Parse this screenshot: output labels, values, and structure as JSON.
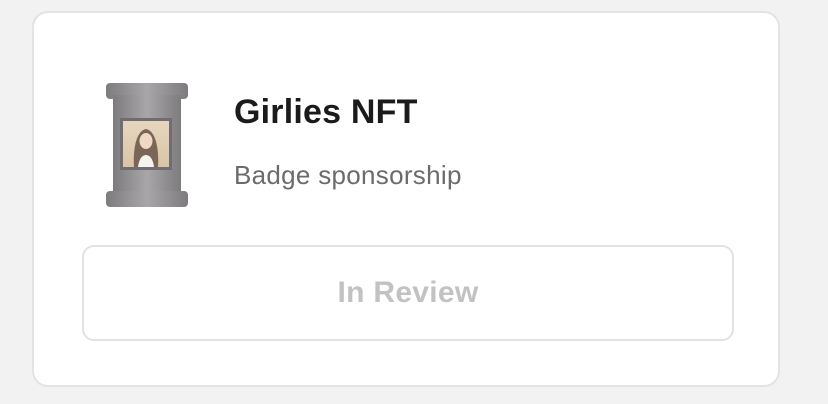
{
  "card": {
    "title": "Girlies NFT",
    "subtitle": "Badge sponsorship",
    "badge_icon": "nft-badge-icon",
    "status_label": "In Review"
  },
  "colors": {
    "card_background": "#ffffff",
    "card_border": "#e3e3e3",
    "title": "#1b1b1b",
    "subtitle": "#6b6b6b",
    "status_text": "#c2c2c2",
    "badge_frame": "#8f8d8f"
  }
}
